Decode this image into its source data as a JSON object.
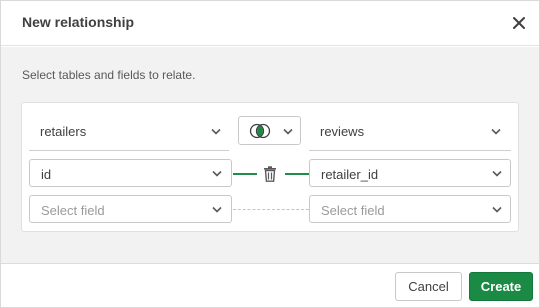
{
  "dialog": {
    "title": "New relationship",
    "instructions": "Select tables and fields to relate."
  },
  "left_table": {
    "value": "retailers"
  },
  "right_table": {
    "value": "reviews"
  },
  "join_type": {
    "icon": "venn-inner-join-icon"
  },
  "pairs": [
    {
      "left_field": "id",
      "right_field": "retailer_id"
    }
  ],
  "empty_pair": {
    "left_placeholder": "Select field",
    "right_placeholder": "Select field"
  },
  "footer": {
    "cancel_label": "Cancel",
    "create_label": "Create"
  },
  "colors": {
    "accent": "#1b8a45",
    "link_line": "#1f8f47"
  }
}
